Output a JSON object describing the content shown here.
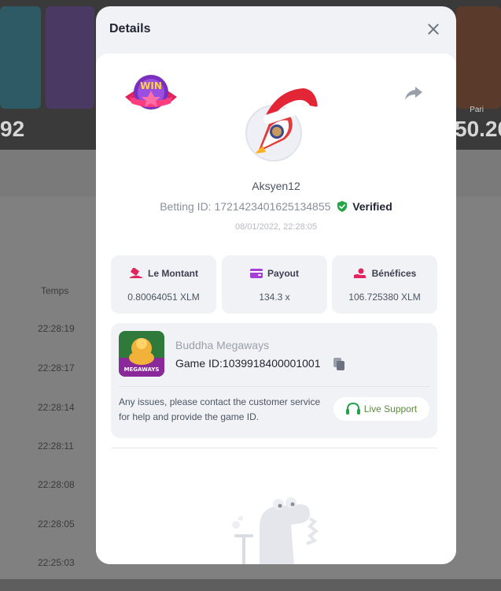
{
  "background": {
    "numbers": [
      "92",
      "50.20"
    ],
    "pari_label": "Pari",
    "table_header": "Temps",
    "times": [
      "22:28:19",
      "22:28:17",
      "22:28:14",
      "22:28:11",
      "22:28:08",
      "22:28:05",
      "22:25:03"
    ]
  },
  "modal": {
    "title": "Details",
    "win_badge": "WIN",
    "username": "Aksyen12",
    "betting_id_label": "Betting ID:",
    "betting_id": "1721423401625134855",
    "verified": "Verified",
    "timestamp": "08/01/2022, 22:28:05",
    "stats": [
      {
        "label": "Le Montant",
        "value": "0.80064051 XLM",
        "icon": "bet-icon"
      },
      {
        "label": "Payout",
        "value": "134.3 x",
        "icon": "wallet-icon"
      },
      {
        "label": "Bénéfices",
        "value": "106.725380 XLM",
        "icon": "profit-icon"
      }
    ],
    "game": {
      "name": "Buddha Megaways",
      "id_label": "Game ID:",
      "id": "1039918400001001",
      "thumb_text": "MEGAWAYS"
    },
    "support_text": "Any issues, please contact the customer service for help and provide the game ID.",
    "support_button": "Live Support"
  },
  "colors": {
    "accent_green": "#22a447",
    "support_green": "#5a8a3c",
    "modal_bg": "#f1f2f6"
  }
}
